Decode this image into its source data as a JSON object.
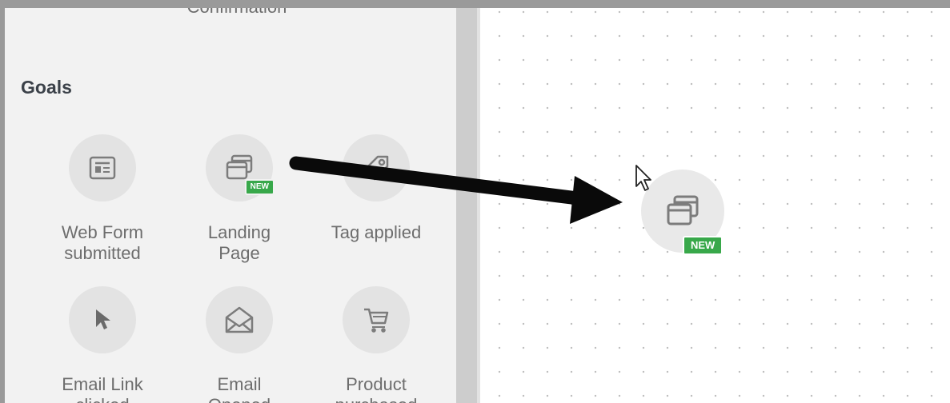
{
  "sidebar": {
    "cut_label": "Confirmation",
    "section_title": "Goals",
    "goals": [
      {
        "label_1": "Web Form",
        "label_2": "submitted",
        "icon": "web-form-icon"
      },
      {
        "label_1": "Landing",
        "label_2": "Page",
        "icon": "landing-page-icon",
        "badge": "NEW"
      },
      {
        "label_1": "Tag applied",
        "label_2": "",
        "icon": "tag-icon"
      },
      {
        "label_1": "Email Link",
        "label_2": "clicked",
        "icon": "cursor-click-icon"
      },
      {
        "label_1": "Email",
        "label_2": "Opened",
        "icon": "envelope-open-icon"
      },
      {
        "label_1": "Product",
        "label_2": "purchased",
        "icon": "shopping-cart-icon"
      }
    ]
  },
  "canvas": {
    "node": {
      "badge": "NEW",
      "icon": "landing-page-icon"
    }
  },
  "colors": {
    "badge": "#38a84a",
    "icon": "#7c7c7c",
    "circle": "#e3e3e3",
    "sidebar": "#f2f2f2"
  }
}
